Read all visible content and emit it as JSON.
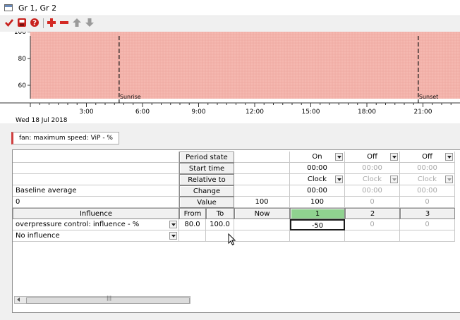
{
  "window": {
    "title": "Gr 1, Gr 2"
  },
  "toolbar": {
    "icons": [
      "checkmark-icon",
      "save-icon",
      "help-icon",
      "add-icon",
      "remove-icon",
      "move-up-icon",
      "move-down-icon"
    ]
  },
  "chart": {
    "date_label": "Wed 18 Jul 2018",
    "y_ticks": [
      "100",
      "80",
      "60"
    ],
    "x_ticks": [
      "3:00",
      "6:00",
      "9:00",
      "12:00",
      "15:00",
      "18:00",
      "21:00"
    ],
    "sunrise_label": "Sunrise",
    "sunset_label": "Sunset",
    "fill_color": "#f5b8b0"
  },
  "chart_data": {
    "type": "area",
    "x": [
      "0:00",
      "3:00",
      "6:00",
      "9:00",
      "12:00",
      "15:00",
      "18:00",
      "21:00",
      "23:59"
    ],
    "values": [
      100,
      100,
      100,
      100,
      100,
      100,
      100,
      100,
      100
    ],
    "ylim": [
      50,
      100
    ],
    "y_ticks": [
      60,
      80,
      100
    ],
    "annotations": [
      {
        "label": "Sunrise",
        "x": "4:45"
      },
      {
        "label": "Sunset",
        "x": "20:45"
      }
    ]
  },
  "schedule_tab": {
    "label": "fan: maximum speed: ViP - %"
  },
  "grid": {
    "row_period_state": {
      "label": "Period state",
      "values": [
        "On",
        "Off",
        "Off"
      ]
    },
    "row_start_time": {
      "label": "Start time",
      "values": [
        "00:00",
        "00:00",
        "00:00"
      ]
    },
    "row_relative_to": {
      "label": "Relative to",
      "values": [
        "Clock",
        "Clock",
        "Clock"
      ]
    },
    "row_change": {
      "left_label": "Baseline average",
      "label": "Change",
      "values": [
        "00:00",
        "00:00",
        "00:00"
      ]
    },
    "row_value": {
      "left_value": "0",
      "label": "Value",
      "now": "100",
      "values": [
        "100",
        "0",
        "0"
      ]
    },
    "header": {
      "influence": "Influence",
      "from": "From",
      "to": "To",
      "now": "Now",
      "periods": [
        "1",
        "2",
        "3"
      ]
    },
    "influence_rows": [
      {
        "name": "overpressure control: influence - %",
        "from": "80.0",
        "to": "100.0",
        "now": "",
        "values": [
          "-50",
          "0",
          "0"
        ]
      },
      {
        "name": "No influence",
        "from": "",
        "to": "",
        "now": "",
        "values": [
          "",
          "",
          ""
        ]
      }
    ]
  }
}
